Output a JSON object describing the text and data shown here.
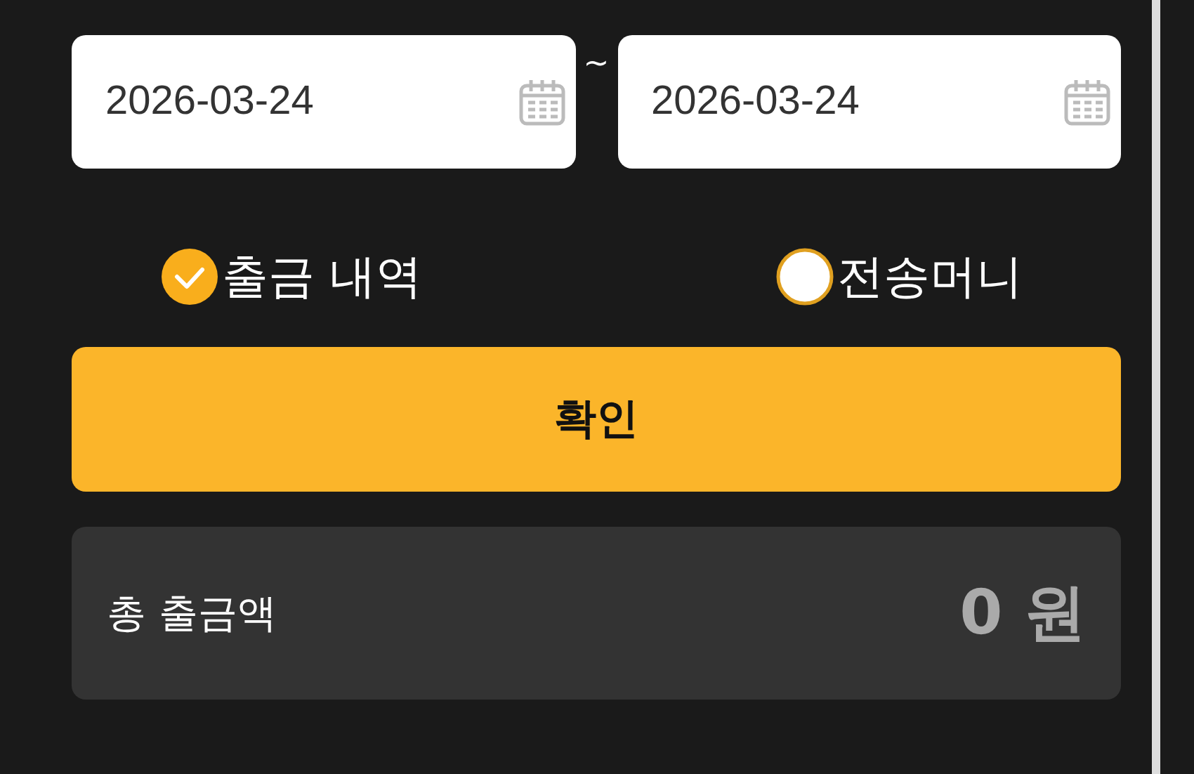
{
  "date_range": {
    "start": "2026-03-24",
    "separator": "~",
    "end": "2026-03-24"
  },
  "options": [
    {
      "label": "출금 내역",
      "selected": true
    },
    {
      "label": "전송머니",
      "selected": false
    }
  ],
  "confirm_button": "확인",
  "total": {
    "label": "총 출금액",
    "amount": "0 원"
  }
}
